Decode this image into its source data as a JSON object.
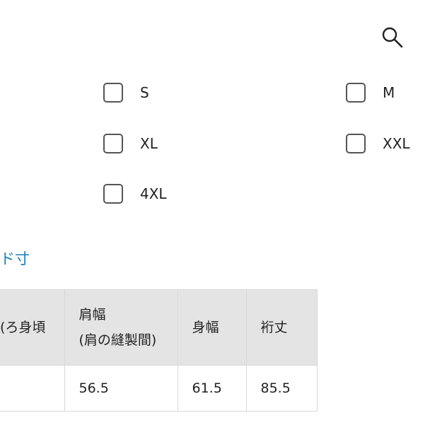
{
  "header": {
    "search_icon": "search-icon"
  },
  "size_filter": {
    "options": [
      {
        "label": "S",
        "checked": false
      },
      {
        "label": "M",
        "checked": false
      },
      {
        "label": "XL",
        "checked": false
      },
      {
        "label": "XXL",
        "checked": false
      },
      {
        "label": "4XL",
        "checked": false
      }
    ]
  },
  "size_link": {
    "label": "ド寸"
  },
  "size_table": {
    "headers": {
      "first": "ろ身頃)",
      "shoulder_line1": "肩幅",
      "shoulder_line2": "(肩の縫製間)",
      "body": "身幅",
      "sleeve": "裄丈"
    },
    "rows": [
      {
        "first": "",
        "shoulder": "56.5",
        "body": "61.5",
        "sleeve": "85.5"
      }
    ]
  },
  "colors": {
    "link": "#1a7fb8",
    "header_bg": "#e4e4e4",
    "border": "#d8d8d8",
    "checkbox_border": "#555555"
  }
}
